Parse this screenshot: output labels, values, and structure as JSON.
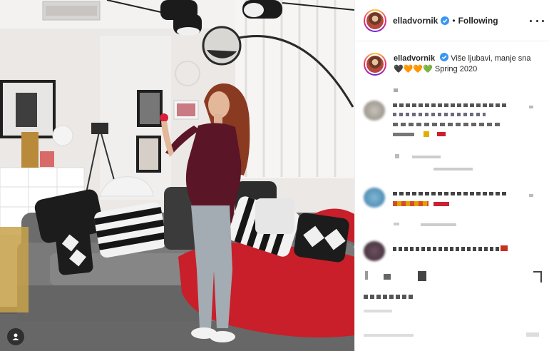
{
  "post": {
    "username": "elladvornik",
    "follow_state": "Following",
    "caption_text": "Više ljubavi, manje sna",
    "caption_hearts": "🖤🧡🧡💚",
    "caption_season": "Spring 2020"
  },
  "icons": {
    "more": "more-options-icon",
    "verified": "verified-badge-icon",
    "tag": "user-tag-icon"
  },
  "colors": {
    "verified": "#3897f0",
    "text": "#262626",
    "divider": "#efefef"
  }
}
